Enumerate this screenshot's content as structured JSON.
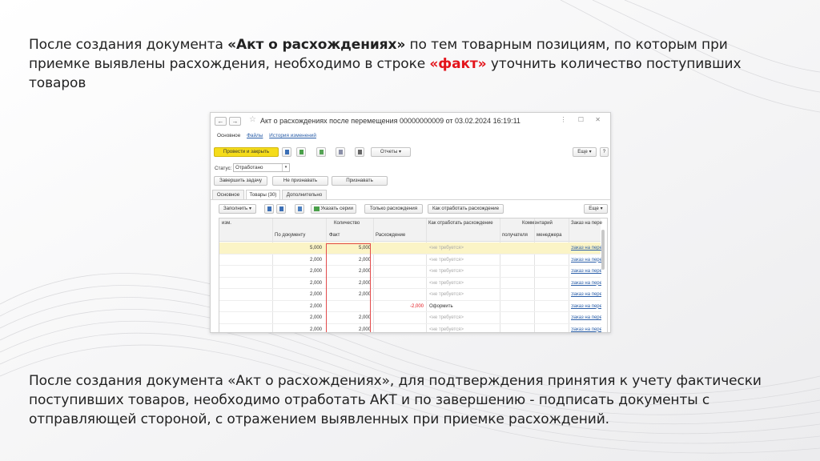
{
  "slide": {
    "top_text": {
      "part1": "После создания документа ",
      "part2_bold": "«Акт о расхождениях»",
      "part3": " по тем товарным позициям, по которым при приемке выявлены расхождения, необходимо в строке ",
      "part4_red": "«факт»",
      "part5": " уточнить количество поступивших товаров"
    },
    "bottom_text": "После создания документа «Акт о расхождениях», для подтверждения принятия к учету фактически поступивших товаров, необходимо отработать АКТ и по завершению - подписать документы с отправляющей стороной, с отражением выявленных при приемке расхождений.",
    "accent_color": "#e3141b"
  },
  "window": {
    "title": "Акт о расхождениях после перемещения 00000000009 от 03.02.2024 16:19:11",
    "nav_back": "←",
    "nav_forward": "→",
    "star": "☆",
    "controls": "⋮ ☐ ✕",
    "top_tabs": [
      "Основное",
      "Файлы",
      "История изменений"
    ],
    "toolbar": {
      "post_close": "Провести и закрыть",
      "reports": "Отчеты ▾",
      "more": "Еще ▾",
      "help": "?"
    },
    "actions": {
      "complete_task": "Завершить задачу",
      "not_accept": "Не признавать",
      "accept": "Признавать"
    },
    "status": {
      "label": "Статус:",
      "value": "Отработано"
    },
    "form_tabs": [
      "Основное",
      "Товары (30)",
      "Дополнительно"
    ],
    "table_toolbar": {
      "fill": "Заполнить ▾",
      "specify_series": "Указать серии",
      "only_discrepancies": "Только расхождения",
      "how_to_process": "Как отработать расхождение",
      "more": "Еще ▾"
    },
    "table": {
      "headers": {
        "unit": "изм.",
        "quantity": "Количество",
        "by_document": "По документу",
        "fact": "Факт",
        "discrepancy": "Расхождение",
        "how_process": "Как отработать расхождение",
        "comments": "Комментарий",
        "recipient": "получателя",
        "manager": "менеджера",
        "order": "Заказ на пере"
      },
      "rows": [
        {
          "doc": "5,000",
          "fact": "5,000",
          "disc": "",
          "how": "<не требуется>",
          "order": "Заказ на пере"
        },
        {
          "doc": "2,000",
          "fact": "2,000",
          "disc": "",
          "how": "<не требуется>",
          "order": "Заказ на пере"
        },
        {
          "doc": "2,000",
          "fact": "2,000",
          "disc": "",
          "how": "<не требуется>",
          "order": "Заказ на пере"
        },
        {
          "doc": "2,000",
          "fact": "2,000",
          "disc": "",
          "how": "<не требуется>",
          "order": "Заказ на пере"
        },
        {
          "doc": "2,000",
          "fact": "2,000",
          "disc": "",
          "how": "<не требуется>",
          "order": "Заказ на пере"
        },
        {
          "doc": "2,000",
          "fact": "",
          "disc": "-2,000",
          "how": "Оформить",
          "order": "Заказ на пере"
        },
        {
          "doc": "2,000",
          "fact": "2,000",
          "disc": "",
          "how": "<не требуется>",
          "order": "Заказ на пере"
        },
        {
          "doc": "2,000",
          "fact": "2,000",
          "disc": "",
          "how": "<не требуется>",
          "order": "Заказ на пере"
        }
      ]
    }
  }
}
